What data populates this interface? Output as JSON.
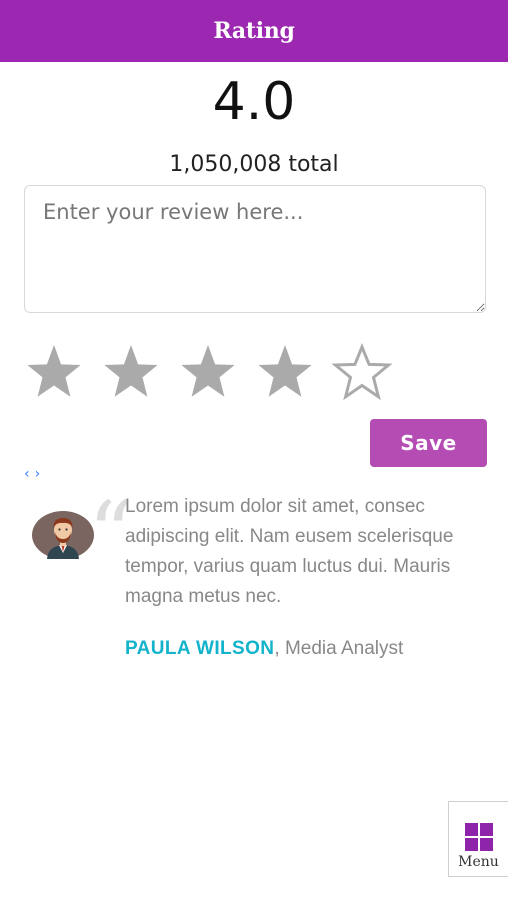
{
  "header": {
    "title": "Rating",
    "background_color": "#9c27b0"
  },
  "rating": {
    "score": "4.0",
    "total": "1,050,008 total",
    "stars": [
      {
        "icon": "star-filled-icon",
        "filled": true
      },
      {
        "icon": "star-filled-icon",
        "filled": true
      },
      {
        "icon": "star-filled-icon",
        "filled": true
      },
      {
        "icon": "star-filled-icon",
        "filled": true
      },
      {
        "icon": "star-empty-icon",
        "filled": false
      }
    ],
    "star_color": "#aaaaaa"
  },
  "review": {
    "placeholder": "Enter your review here...",
    "value": ""
  },
  "save_button": {
    "label": "Save",
    "color": "#b44cb4"
  },
  "carousel": {
    "prev_label": "‹",
    "next_label": "›",
    "link_color": "#3b82f6"
  },
  "testimonial": {
    "quote_mark": "“",
    "text": "Lorem ipsum dolor sit amet, consec adipiscing elit. Nam eusem scelerisque tempor, varius quam luctus dui. Mauris magna metus nec.",
    "author_name": "PAULA WILSON",
    "author_separator": ", ",
    "author_role": "Media Analyst",
    "author_name_color": "#14b3cc"
  },
  "menu": {
    "label": "Menu",
    "icon": "grid-icon",
    "icon_color": "#8e24aa"
  }
}
